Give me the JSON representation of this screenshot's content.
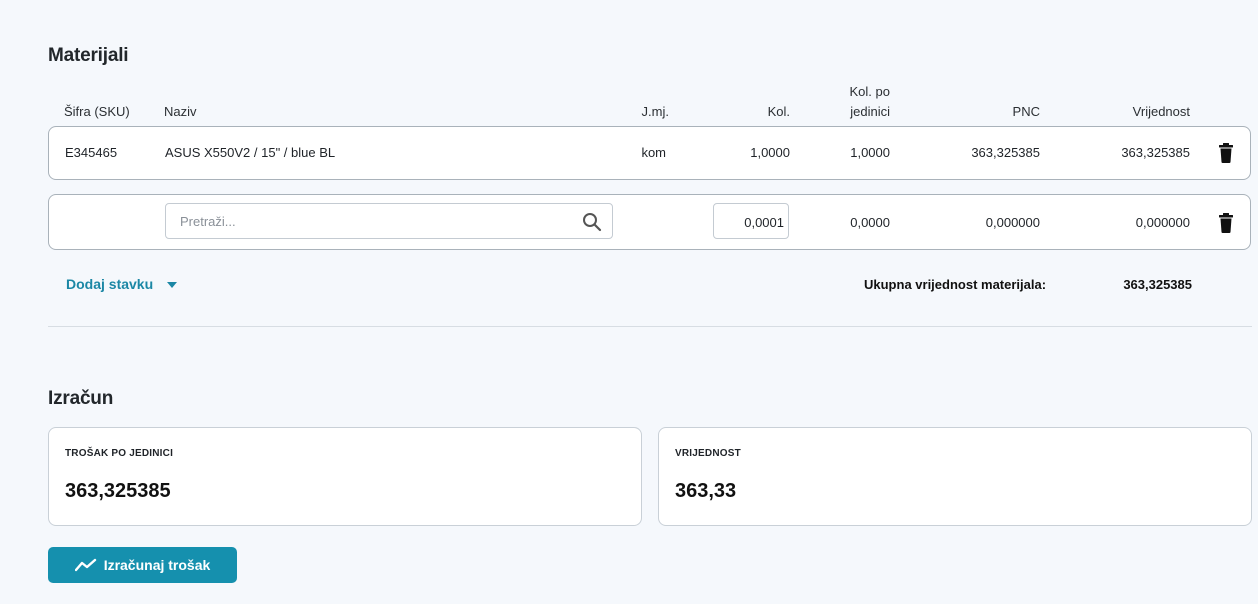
{
  "materials": {
    "title": "Materijali",
    "headers": {
      "sku": "Šifra (SKU)",
      "name": "Naziv",
      "unit": "J.mj.",
      "qty": "Kol.",
      "qty_per_unit_line1": "Kol. po",
      "qty_per_unit_line2": "jedinici",
      "pnc": "PNC",
      "value": "Vrijednost"
    },
    "rows": [
      {
        "sku": "E345465",
        "name": "ASUS X550V2 / 15\" / blue BL",
        "unit": "kom",
        "qty": "1,0000",
        "qty_per_unit": "1,0000",
        "pnc": "363,325385",
        "value": "363,325385"
      }
    ],
    "new_row": {
      "search_placeholder": "Pretraži...",
      "qty_value": "0,0001",
      "qty_per_unit": "0,0000",
      "pnc": "0,000000",
      "value": "0,000000"
    },
    "add_item_label": "Dodaj stavku",
    "total_label": "Ukupna vrijednost materijala:",
    "total_value": "363,325385"
  },
  "calculation": {
    "title": "Izračun",
    "cards": [
      {
        "label": "TROŠAK PO JEDINICI",
        "value": "363,325385"
      },
      {
        "label": "VRIJEDNOST",
        "value": "363,33"
      }
    ],
    "button_label": "Izračunaj trošak"
  },
  "colors": {
    "accent": "#1590ae",
    "link": "#1b87a5",
    "background": "#f5f8fc"
  },
  "icons": {
    "delete": "trash-icon",
    "search": "search-icon",
    "dropdown": "caret-down-icon",
    "calc": "chart-line-icon"
  }
}
